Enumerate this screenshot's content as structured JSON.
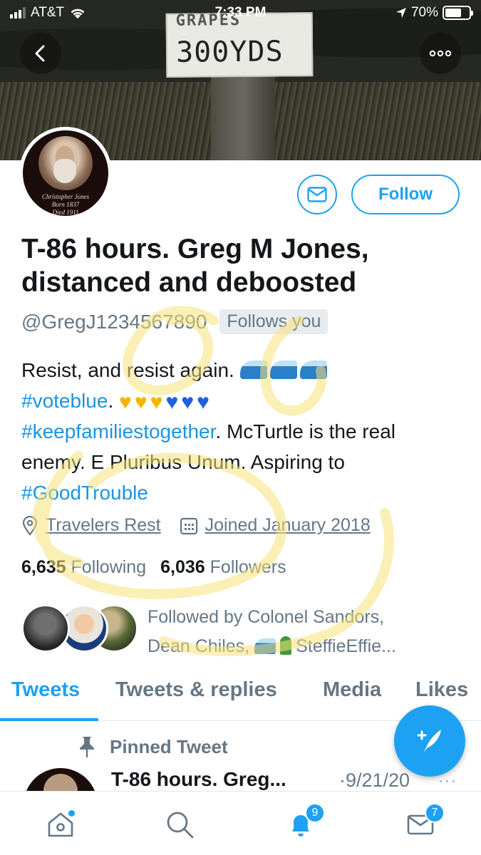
{
  "status_bar": {
    "carrier": "AT&T",
    "time": "7:33 PM",
    "battery": "70%"
  },
  "banner": {
    "sign_line1": "GRAPES",
    "sign_line2": "300YDS"
  },
  "avatar": {
    "caption": "Christopher Jones\nBorn 1837\nDied 1911"
  },
  "actions": {
    "follow_label": "Follow"
  },
  "profile": {
    "name": "T-86 hours. Greg M Jones, distanced and deboosted",
    "handle": "@GregJ1234567890",
    "follows_you": "Follows you",
    "bio": {
      "line1": "Resist, and resist again.",
      "tag_voteblue": "#voteblue",
      "dot": ".",
      "tag_families": "#keepfamiliestogether",
      "text2": ". McTurtle is the real enemy. E Pluribus Unum. Aspiring to",
      "tag_goodtrouble": "#GoodTrouble"
    },
    "location": "Travelers Rest",
    "joined": "Joined January 2018",
    "following_count": "6,635",
    "following_label": "Following",
    "followers_count": "6,036",
    "followers_label": "Followers",
    "followed_by_1": "Followed by Colonel Sandors,",
    "followed_by_2a": "Dean Chiles,",
    "followed_by_2b": "SteffieEffie..."
  },
  "tabs": [
    {
      "label": "Tweets",
      "active": true
    },
    {
      "label": "Tweets & replies",
      "active": false
    },
    {
      "label": "Media",
      "active": false
    },
    {
      "label": "Likes",
      "active": false
    }
  ],
  "pinned": {
    "label": "Pinned Tweet",
    "title": "T-86 hours. Greg...",
    "date": "·9/21/20",
    "more": "···"
  },
  "bottom_nav": {
    "notifications_badge": "9",
    "messages_badge": "7"
  },
  "colors": {
    "accent": "#1da1f2",
    "muted": "#657786",
    "highlighter": "#f7e27a"
  }
}
